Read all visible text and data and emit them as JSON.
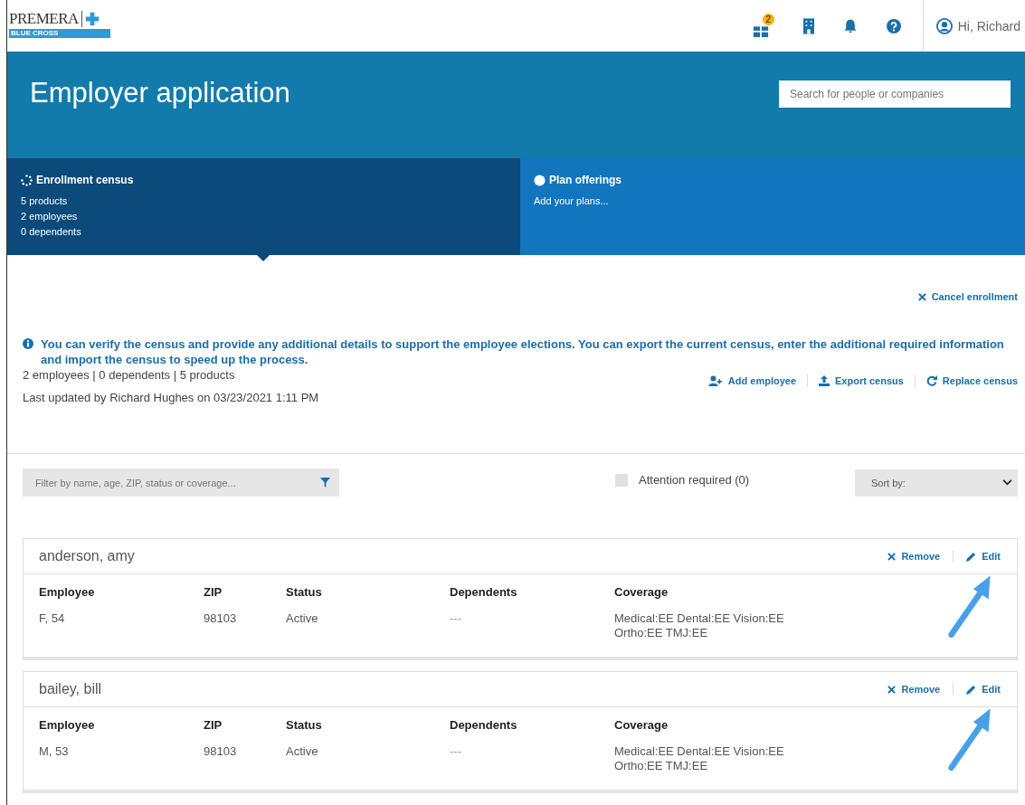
{
  "logo": {
    "name": "PREMERA",
    "band": "BLUE CROSS"
  },
  "header": {
    "notification_count": "2",
    "user": "Hi, Richard"
  },
  "banner": {
    "title": "Employer application",
    "search": {
      "placeholder": "Search for people or companies"
    }
  },
  "steps": [
    {
      "title": "Enrollment census",
      "selected": true,
      "lines": [
        "5 products",
        "2 employees",
        "0 dependents"
      ]
    },
    {
      "title": "Plan offerings",
      "selected": false,
      "lines": [
        "Add your plans..."
      ]
    }
  ],
  "cancel": "Cancel enrollment",
  "info": "You can verify the census and provide any additional details to support the employee elections. You can export the current census, enter the additional required information and import the census to speed up the process.",
  "summary": "2 employees | 0 dependents | 5 products",
  "updated": "Last updated by Richard Hughes on 03/23/2021 1:11 PM",
  "actions": [
    {
      "kind": "add",
      "label": "Add employee"
    },
    {
      "kind": "export",
      "label": "Export census"
    },
    {
      "kind": "replace",
      "label": "Replace census"
    }
  ],
  "filter": {
    "placeholder": "Filter by name, age, ZIP, status or coverage..."
  },
  "attention": {
    "label": "Attention required (0)",
    "checked": false
  },
  "sort": {
    "label": "Sort by:"
  },
  "employees": [
    {
      "columns": [
        "Employee",
        "ZIP",
        "Status",
        "Dependents",
        "Coverage"
      ],
      "name": "anderson, amy",
      "remove": "Remove",
      "edit": "Edit",
      "cells": [
        "F, 54",
        "98103",
        "Active",
        "---"
      ],
      "coverage": [
        "Medical:EE Dental:EE Vision:EE",
        "Ortho:EE TMJ:EE"
      ]
    },
    {
      "columns": [
        "Employee",
        "ZIP",
        "Status",
        "Dependents",
        "Coverage"
      ],
      "name": "bailey, bill",
      "remove": "Remove",
      "edit": "Edit",
      "cells": [
        "M, 53",
        "98103",
        "Active",
        "---"
      ],
      "coverage": [
        "Medical:EE Dental:EE Vision:EE",
        "Ortho:EE TMJ:EE"
      ]
    }
  ]
}
